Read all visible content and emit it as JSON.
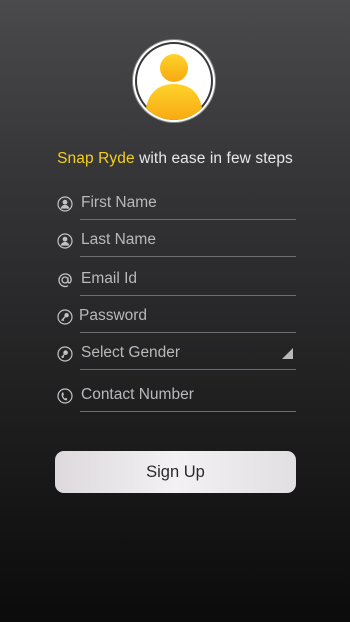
{
  "header": {
    "tagline_brand": "Snap Ryde",
    "tagline_rest": " with ease in few steps"
  },
  "avatar": {
    "icon": "user-avatar-icon",
    "color": "#fbb81c"
  },
  "form": {
    "fields": [
      {
        "label": "First Name",
        "icon": "person-icon"
      },
      {
        "label": "Last Name",
        "icon": "person-icon"
      },
      {
        "label": "Email Id",
        "icon": "at-sign-icon"
      },
      {
        "label": "Password",
        "icon": "key-icon"
      },
      {
        "label": "Select Gender",
        "icon": "gender-icon"
      },
      {
        "label": "Contact Number",
        "icon": "phone-icon"
      }
    ],
    "submit_label": "Sign Up"
  },
  "colors": {
    "brand": "#f2cf1f",
    "text": "#e8e8e8",
    "placeholder": "#b9b9bb"
  }
}
